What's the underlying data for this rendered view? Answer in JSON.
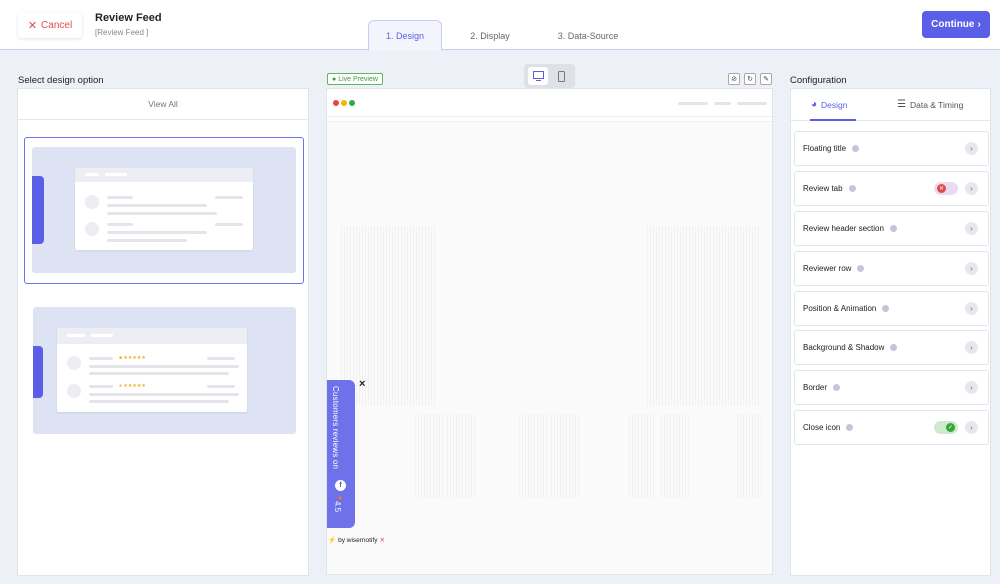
{
  "header": {
    "cancel_label": "Cancel",
    "title": "Review Feed",
    "subtitle": "[Review Feed ]",
    "continue_label": "Continue",
    "tabs": [
      {
        "label": "1. Design",
        "active": true
      },
      {
        "label": "2. Display",
        "active": false
      },
      {
        "label": "3. Data-Source",
        "active": false
      }
    ]
  },
  "left": {
    "section_title": "Select design option",
    "view_all_label": "View All"
  },
  "preview": {
    "live_badge": "Live Preview",
    "review_tab_text": "Customers reviews on",
    "review_tab_rating": "4.5",
    "close_glyph": "×",
    "powered_by": "by wisernotify",
    "device_modes": [
      "desktop",
      "mobile"
    ],
    "dot_colors": [
      "#e8453c",
      "#f5b400",
      "#34a853"
    ]
  },
  "config": {
    "section_title": "Configuration",
    "tabs": [
      {
        "label": "Design",
        "icon": "palette-icon",
        "active": true
      },
      {
        "label": "Data & Timing",
        "icon": "sliders-icon",
        "active": false
      }
    ],
    "rows": [
      {
        "label": "Floating title",
        "toggle": null
      },
      {
        "label": "Review tab",
        "toggle": "off"
      },
      {
        "label": "Review header section",
        "toggle": null
      },
      {
        "label": "Reviewer row",
        "toggle": null
      },
      {
        "label": "Position & Animation",
        "toggle": null
      },
      {
        "label": "Background & Shadow",
        "toggle": null
      },
      {
        "label": "Border",
        "toggle": null
      },
      {
        "label": "Close icon",
        "toggle": "on"
      }
    ]
  },
  "colors": {
    "accent": "#5b5fe8",
    "cancel": "#e24b4b",
    "toggle_on": "#37a537"
  }
}
